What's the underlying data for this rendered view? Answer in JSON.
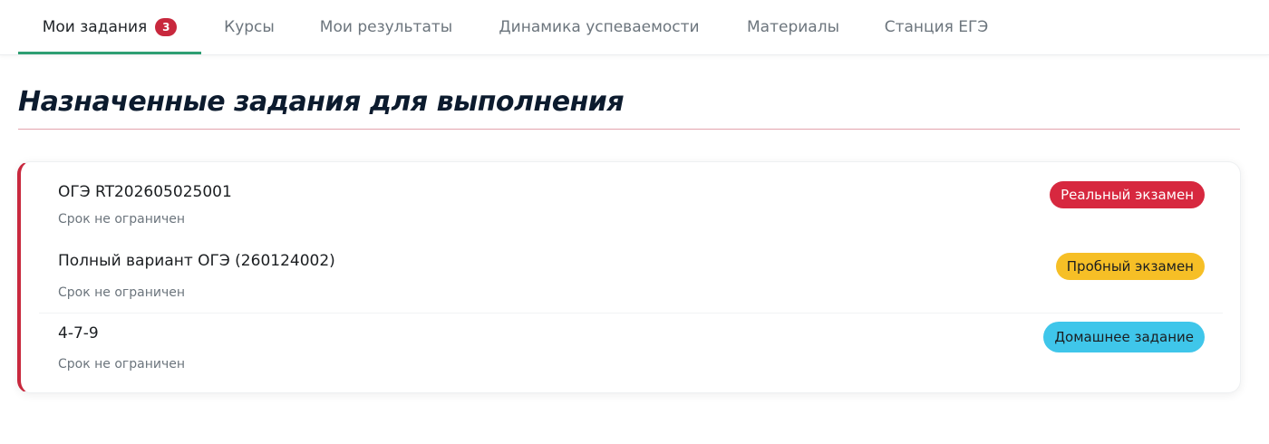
{
  "nav": {
    "tabs": [
      {
        "label": "Мои задания",
        "badge": "3",
        "active": true
      },
      {
        "label": "Курсы"
      },
      {
        "label": "Мои результаты"
      },
      {
        "label": "Динамика успеваемости"
      },
      {
        "label": "Материалы"
      },
      {
        "label": "Станция ЕГЭ"
      }
    ]
  },
  "main": {
    "title": "Назначенные задания для выполнения",
    "assignments": [
      {
        "name": "ОГЭ RT202605025001",
        "deadline": "Срок не ограничен",
        "type_label": "Реальный экзамен",
        "type_bg": "#d7283f",
        "type_fg": "#ffffff"
      },
      {
        "name": "Полный вариант ОГЭ (260124002)",
        "deadline": "Срок не ограничен",
        "type_label": "Пробный экзамен",
        "type_bg": "#f6bf26",
        "type_fg": "#1b1e21"
      },
      {
        "name": "4-7-9",
        "deadline": "Срок не ограничен",
        "type_label": "Домашнее задание",
        "type_bg": "#3fc6ea",
        "type_fg": "#1b1e21"
      }
    ]
  },
  "colors": {
    "accent": "#2e9e72",
    "card_border": "#c8283d",
    "title_rule": "#e3a3ad"
  }
}
